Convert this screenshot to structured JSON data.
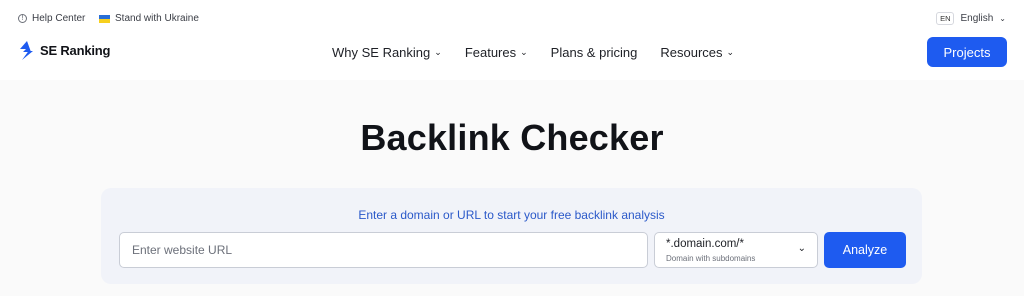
{
  "topbar": {
    "help_label": "Help Center",
    "help_icon": "help-circle-icon",
    "ukraine_label": "Stand with Ukraine",
    "ukraine_icon": "ukraine-flag-icon",
    "lang_code": "EN",
    "lang_label": "English"
  },
  "nav": {
    "logo_text": "SE Ranking",
    "menu": [
      {
        "label": "Why SE Ranking",
        "has_dropdown": true
      },
      {
        "label": "Features",
        "has_dropdown": true
      },
      {
        "label": "Plans & pricing",
        "has_dropdown": false
      },
      {
        "label": "Resources",
        "has_dropdown": true
      }
    ],
    "projects_label": "Projects"
  },
  "hero": {
    "title": "Backlink Checker"
  },
  "search": {
    "caption": "Enter a domain or URL to start your free backlink analysis",
    "placeholder": "Enter website URL",
    "scope_value": "*.domain.com/*",
    "scope_sub": "Domain with subdomains",
    "analyze_label": "Analyze"
  },
  "colors": {
    "accent": "#1e5bf0",
    "caption": "#2b59c9",
    "panel_bg": "#f1f3f9"
  }
}
